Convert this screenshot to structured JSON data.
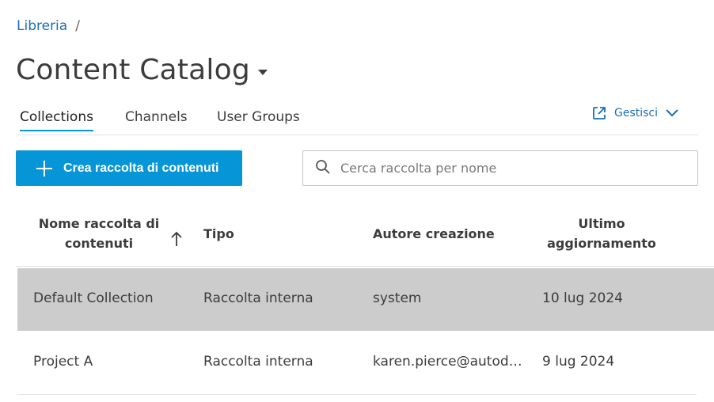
{
  "breadcrumb": {
    "root": "Libreria",
    "separator": "/"
  },
  "page": {
    "title": "Content Catalog"
  },
  "tabs": [
    {
      "label": "Collections",
      "active": true
    },
    {
      "label": "Channels",
      "active": false
    },
    {
      "label": "User Groups",
      "active": false
    }
  ],
  "manage": {
    "label": "Gestisci",
    "icon": "external-link-icon"
  },
  "toolbar": {
    "create_label": "Crea raccolta di contenuti",
    "search_placeholder": "Cerca raccolta per nome"
  },
  "table": {
    "headers": {
      "name": "Nome raccolta di contenuti",
      "tipo": "Tipo",
      "autore": "Autore creazione",
      "ultimo": "Ultimo aggiornamento"
    },
    "sort": {
      "column": "name",
      "direction": "ascending"
    },
    "rows": [
      {
        "name": "Default Collection",
        "tipo": "Raccolta interna",
        "autore": "system",
        "date": "10 lug 2024",
        "selected": true
      },
      {
        "name": "Project A",
        "tipo": "Raccolta interna",
        "autore": "karen.pierce@autode...",
        "date": "9 lug 2024",
        "selected": false
      }
    ]
  },
  "colors": {
    "accent": "#0696d7",
    "link": "#1a6fb5",
    "selected_row": "#cccccc"
  }
}
